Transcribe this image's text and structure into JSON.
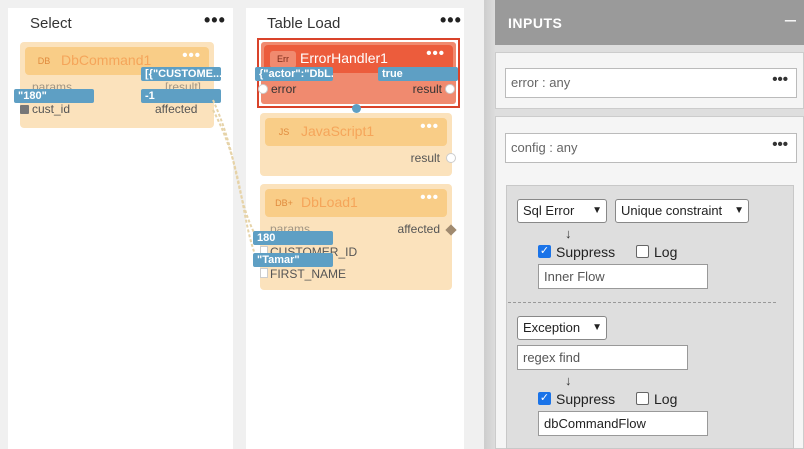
{
  "select_column": {
    "title": "Select",
    "menu": "•••",
    "db_command": {
      "badge": "DB",
      "title": "DbCommand1",
      "menu": "•••",
      "params_label": "params",
      "result_label": "[result]",
      "cust_id_label": "cust_id",
      "affected_label": "affected",
      "result_value": "[{\"CUSTOME...",
      "cust_id_value": "\"180\"",
      "affected_value": "-1"
    }
  },
  "table_load_column": {
    "title": "Table Load",
    "menu": "•••",
    "error_handler": {
      "badge": "Err",
      "title": "ErrorHandler1",
      "menu": "•••",
      "error_value": "{\"actor\":\"DbL...",
      "result_value": "true",
      "error_label": "error",
      "result_label": "result"
    },
    "javascript": {
      "badge": "JS",
      "title": "JavaScript1",
      "menu": "•••",
      "result_label": "result"
    },
    "db_load": {
      "badge": "DB+",
      "title": "DbLoad1",
      "menu": "•••",
      "params_label": "params",
      "affected_label": "affected",
      "customer_id_label": "CUSTOMER_ID",
      "first_name_label": "FIRST_NAME",
      "customer_id_value": "180",
      "first_name_value": "\"Tamar\""
    }
  },
  "inputs_panel": {
    "title": "INPUTS",
    "collapse": "–",
    "error_field": "error : any",
    "config_field": "config : any",
    "field_menu": "•••",
    "rule1": {
      "type": "Sql Error",
      "subtype": "Unique constraint",
      "arrow": "↓",
      "suppress_label": "Suppress",
      "suppress_checked": true,
      "log_label": "Log",
      "log_checked": false,
      "flow_placeholder": "Inner Flow"
    },
    "rule2": {
      "type": "Exception",
      "regex_placeholder": "regex find",
      "arrow": "↓",
      "suppress_label": "Suppress",
      "suppress_checked": true,
      "log_label": "Log",
      "log_checked": false,
      "flow_value": "dbCommandFlow"
    }
  },
  "colors": {
    "card_bg": "#fbe2bc",
    "card_head": "#f9cd87",
    "error_card": "#f08a6f",
    "error_head": "#ec5c3c",
    "value_tag": "#5e9fc4",
    "panel_head": "#9a9a9a"
  }
}
